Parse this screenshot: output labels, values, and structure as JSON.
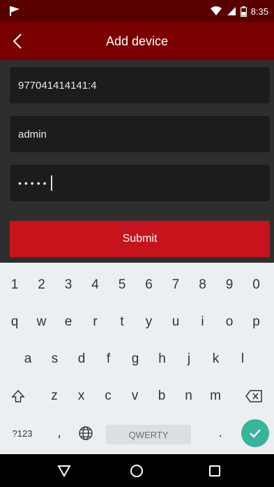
{
  "status_bar": {
    "time": "8:35",
    "icons": [
      "notification-flag-icon",
      "wifi-icon",
      "signal-icon",
      "battery-icon"
    ]
  },
  "header": {
    "title": "Add device",
    "back_icon": "chevron-left-icon"
  },
  "form": {
    "device_field_value": "977041414141:4",
    "username_field_value": "admin",
    "password_mask": "•••••",
    "submit_label": "Submit"
  },
  "keyboard": {
    "digits": [
      "1",
      "2",
      "3",
      "4",
      "5",
      "6",
      "7",
      "8",
      "9",
      "0"
    ],
    "row1": [
      "q",
      "w",
      "e",
      "r",
      "t",
      "y",
      "u",
      "i",
      "o",
      "p"
    ],
    "row2": [
      "a",
      "s",
      "d",
      "f",
      "g",
      "h",
      "j",
      "k",
      "l"
    ],
    "row3": [
      "z",
      "x",
      "c",
      "v",
      "b",
      "n",
      "m"
    ],
    "symbols_label": "?123",
    "comma_label": ",",
    "space_label": "QWERTY",
    "period_label": "."
  },
  "colors": {
    "status_bar": "#5a0000",
    "title_bar": "#7a0000",
    "form_bg": "#2e2e2e",
    "field_bg": "#1c1c1c",
    "submit": "#c6131c",
    "keyboard_bg": "#eceff1",
    "done_key": "#39b39a"
  }
}
